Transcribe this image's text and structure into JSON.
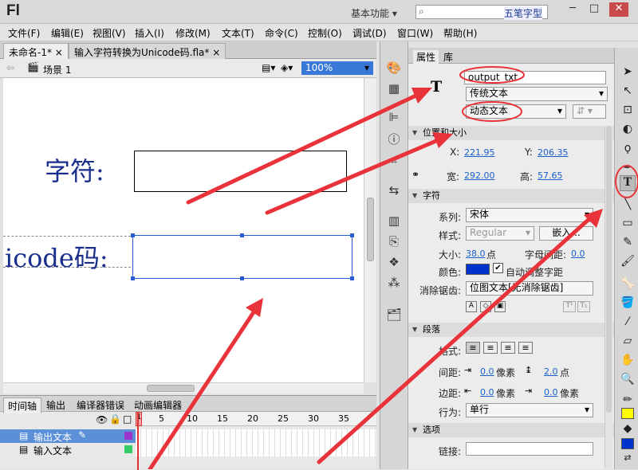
{
  "app": {
    "logo": "Fl",
    "workspace": "基本功能",
    "ime_label": "五笔字型"
  },
  "menu": [
    "文件(F)",
    "编辑(E)",
    "视图(V)",
    "插入(I)",
    "修改(M)",
    "文本(T)",
    "命令(C)",
    "控制(O)",
    "调试(D)",
    "窗口(W)",
    "帮助(H)"
  ],
  "tabs": [
    "未命名-1*",
    "输入字符转换为Unicode码.fla*"
  ],
  "scene": {
    "label": "场景 1",
    "zoom": "100%"
  },
  "stage": {
    "label1": "字符:",
    "label2": "icode码:"
  },
  "timeline": {
    "tabs": [
      "时间轴",
      "输出",
      "编译器错误",
      "动画编辑器"
    ],
    "frames": [
      "1",
      "5",
      "10",
      "15",
      "20",
      "25",
      "30",
      "35"
    ],
    "layers": [
      "输出文本",
      "输入文本"
    ]
  },
  "props": {
    "tabs": [
      "属性",
      "库"
    ],
    "instance_name": "output_txt",
    "text_engine": "传统文本",
    "text_type": "动态文本",
    "pos_section": "位置和大小",
    "x_label": "X:",
    "x": "221.95",
    "y_label": "Y:",
    "y": "206.35",
    "w_label": "宽:",
    "w": "292.00",
    "h_label": "高:",
    "h": "57.65",
    "char_section": "字符",
    "family_label": "系列:",
    "family": "宋体",
    "style_label": "样式:",
    "style": "Regular",
    "embed": "嵌入...",
    "size_label": "大小:",
    "size": "38.0",
    "size_unit": "点",
    "spacing_label": "字母间距:",
    "spacing": "0.0",
    "color_label": "颜色:",
    "autokern": "自动调整字距",
    "aa_label": "消除锯齿:",
    "aa": "位图文本[无消除锯齿]",
    "para_section": "段落",
    "format_label": "格式:",
    "gap_label": "间距:",
    "indent": "0.0",
    "px": "像素",
    "line": "2.0",
    "pt": "点",
    "margin_label": "边距:",
    "margin_l": "0.0",
    "margin_r": "0.0",
    "behavior_label": "行为:",
    "behavior": "单行",
    "options_section": "选项",
    "link_label": "链接:"
  },
  "colors": {
    "accent_red": "#e8333a",
    "fill_blue": "#0033cc",
    "fill_yellow": "#ffff00"
  }
}
